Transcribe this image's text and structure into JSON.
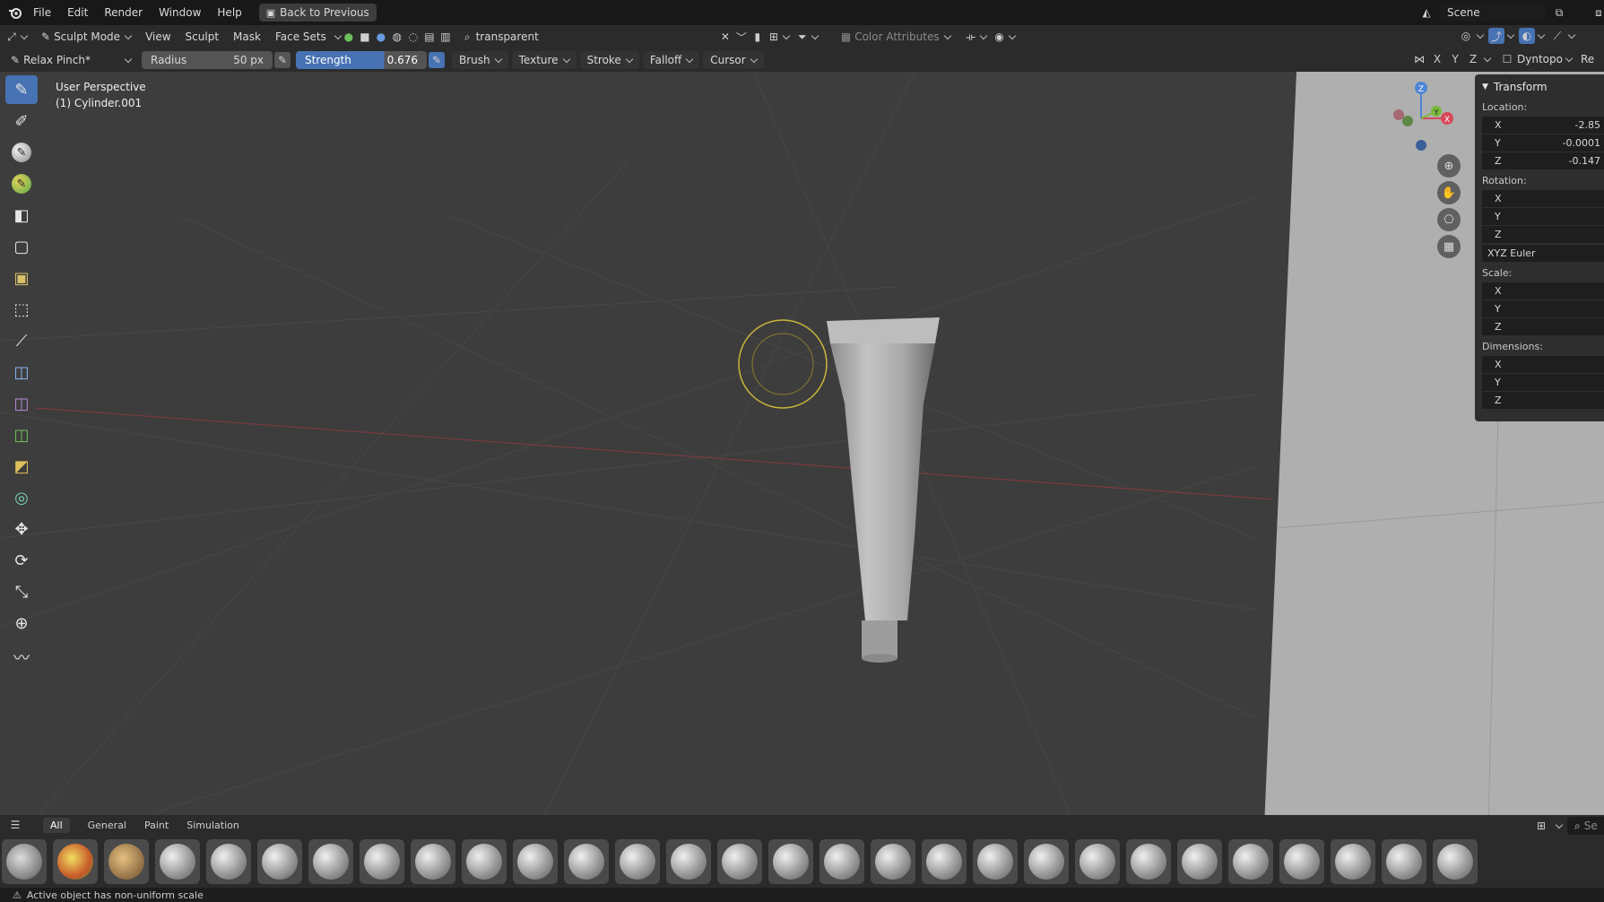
{
  "topbar": {
    "menus": [
      "File",
      "Edit",
      "Render",
      "Window",
      "Help"
    ],
    "back_button": "Back to Previous",
    "scene_label": "Scene"
  },
  "header": {
    "mode": "Sculpt Mode",
    "menus": [
      "View",
      "Sculpt",
      "Mask",
      "Face Sets"
    ],
    "search_value": "transparent",
    "color_attributes": "Color Attributes"
  },
  "tool_header": {
    "brush_name": "Relax Pinch*",
    "radius_label": "Radius",
    "radius_value": "50 px",
    "strength_label": "Strength",
    "strength_value": "0.676",
    "strength": 0.676,
    "menus": [
      "Brush",
      "Texture",
      "Stroke",
      "Falloff",
      "Cursor"
    ],
    "axis_x": "X",
    "axis_y": "Y",
    "axis_z": "Z",
    "dyntopo": "Dyntopo",
    "remesh_short": "Re"
  },
  "viewport": {
    "view_name": "User Perspective",
    "object_name": "(1) Cylinder.001"
  },
  "gizmo": {
    "z": "Z",
    "y": "Y",
    "x": "X"
  },
  "npanel": {
    "title": "Transform",
    "location_label": "Location:",
    "location": {
      "x": "-2.85",
      "y": "-0.0001",
      "z": "-0.147"
    },
    "rotation_label": "Rotation:",
    "rotation_mode": "XYZ Euler",
    "scale_label": "Scale:",
    "dimensions_label": "Dimensions:",
    "axis_labels": {
      "x": "X",
      "y": "Y",
      "z": "Z"
    }
  },
  "asset_shelf": {
    "tabs": [
      "All",
      "General",
      "Paint",
      "Simulation"
    ],
    "search_short": "Se"
  },
  "status": {
    "message": "Active object has non-uniform scale"
  }
}
